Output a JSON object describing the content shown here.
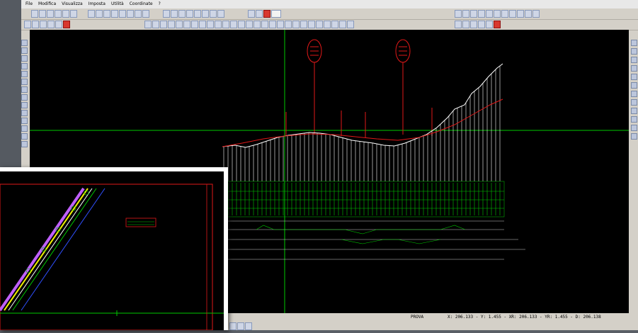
{
  "menu": {
    "items": [
      {
        "label": "File"
      },
      {
        "label": "Modifica"
      },
      {
        "label": "Visualizza"
      },
      {
        "label": "Imposta"
      },
      {
        "label": "Utilità"
      },
      {
        "label": "Coordinate"
      },
      {
        "label": "?"
      }
    ]
  },
  "status": {
    "mode": "PROVA",
    "coords": "X:  206.133 - Y:    1.455 - XR:  206.133 - YR:    1.455 - D:  206.138"
  },
  "colors": {
    "canvas_bg": "#000000",
    "grid_green": "#00c800",
    "profile_white": "#ffffff",
    "profile_red": "#e01818"
  }
}
